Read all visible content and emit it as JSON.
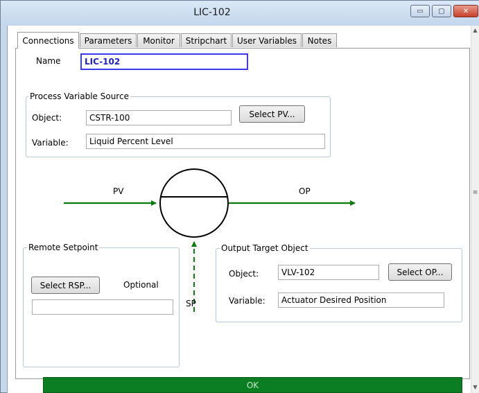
{
  "window": {
    "title": "LIC-102",
    "minimize_glyph": "▭",
    "maximize_glyph": "▢",
    "close_glyph": "✕"
  },
  "tabs": [
    {
      "label": "Connections",
      "active": true
    },
    {
      "label": "Parameters"
    },
    {
      "label": "Monitor"
    },
    {
      "label": "Stripchart"
    },
    {
      "label": "User Variables"
    },
    {
      "label": "Notes"
    }
  ],
  "name": {
    "label": "Name",
    "value": "LIC-102"
  },
  "pv_source": {
    "title": "Process Variable Source",
    "object_label": "Object:",
    "object_value": "CSTR-100",
    "select_button": "Select PV...",
    "variable_label": "Variable:",
    "variable_value": "Liquid Percent Level"
  },
  "diagram": {
    "pv_label": "PV",
    "op_label": "OP",
    "sp_label": "SP",
    "arrow_color": "#0a7a0a"
  },
  "remote_setpoint": {
    "title": "Remote Setpoint",
    "select_button": "Select RSP...",
    "optional_label": "Optional",
    "value": ""
  },
  "output_target": {
    "title": "Output Target Object",
    "object_label": "Object:",
    "object_value": "VLV-102",
    "select_button": "Select OP...",
    "variable_label": "Variable:",
    "variable_value": "Actuator Desired Position"
  },
  "ok_button": {
    "label": "OK",
    "color": "#0b7d22"
  },
  "scrollbar": {
    "up_glyph": "▲",
    "down_glyph": "▼",
    "grip_glyph": "≡"
  }
}
